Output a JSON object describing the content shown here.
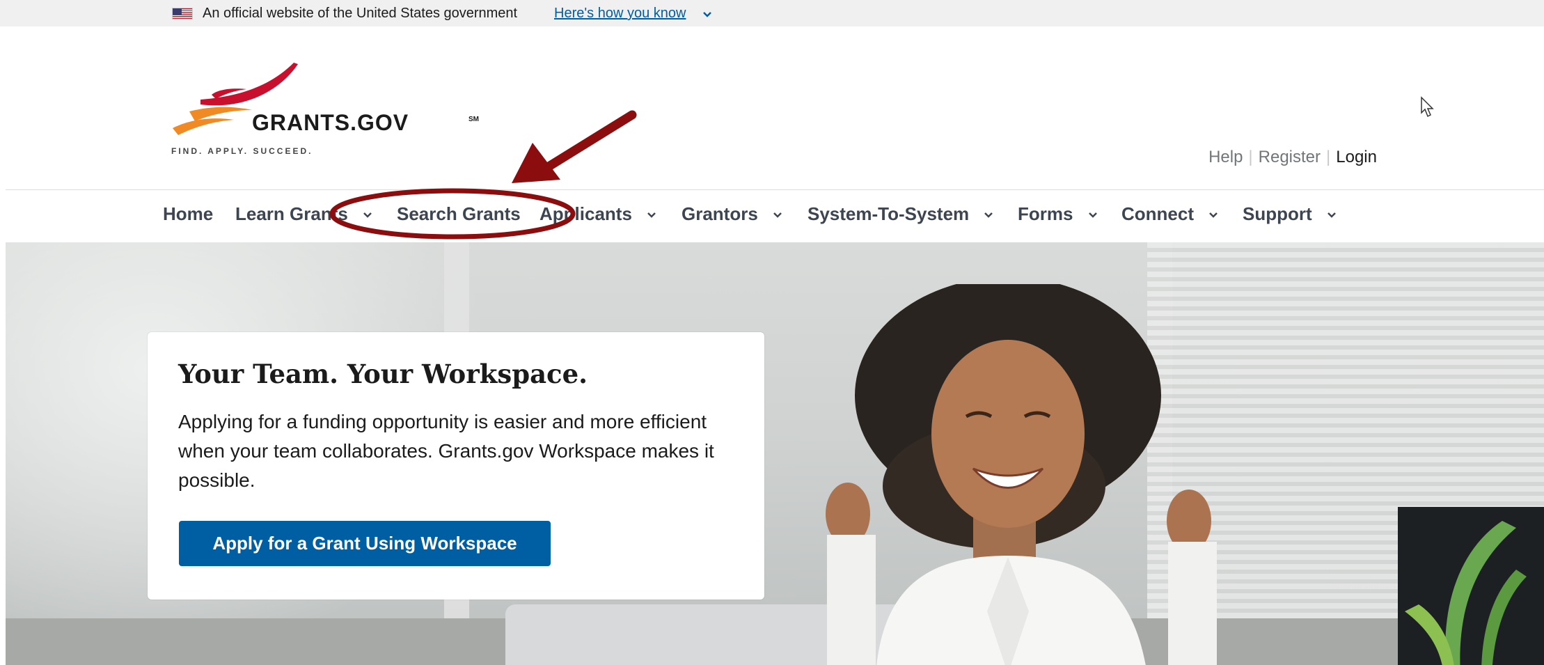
{
  "banner": {
    "text": "An official website of the United States government",
    "link": "Here's how you know"
  },
  "logo": {
    "wordmark": "GRANTS.GOV",
    "mark": "SM",
    "tagline": "FIND. APPLY. SUCCEED."
  },
  "utility": {
    "help": "Help",
    "register": "Register",
    "login": "Login"
  },
  "nav": {
    "items": [
      {
        "label": "Home"
      },
      {
        "label": "Learn Grants"
      },
      {
        "label": "Search Grants"
      },
      {
        "label": "Applicants"
      },
      {
        "label": "Grantors"
      },
      {
        "label": "System-To-System"
      },
      {
        "label": "Forms"
      },
      {
        "label": "Connect"
      },
      {
        "label": "Support"
      }
    ]
  },
  "hero": {
    "title": "Your Team. Your Workspace.",
    "body": "Applying for a funding opportunity is easier and more efficient when your team collaborates. Grants.gov Workspace makes it possible.",
    "button": "Apply for a Grant Using Workspace"
  },
  "colors": {
    "primary_button": "#005ea2",
    "link": "#005ea2",
    "annotation": "#8b0d0d",
    "logo_red": "#c8102e",
    "logo_orange": "#f08a24"
  },
  "icons": {
    "flag": "us-flag-icon",
    "chevron": "chevron-down-icon",
    "cursor": "mouse-cursor-icon"
  }
}
